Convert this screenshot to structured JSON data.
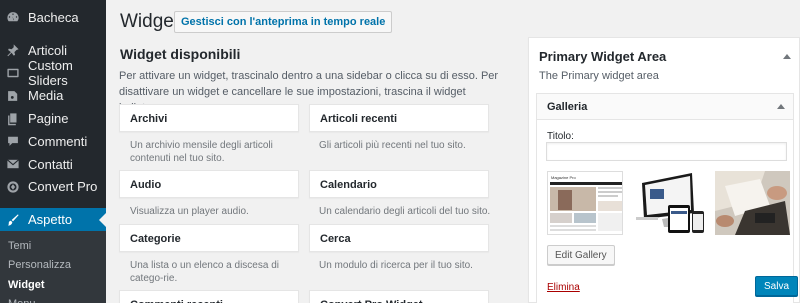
{
  "sidebar": {
    "items": [
      {
        "label": "Bacheca",
        "icon": "dashboard-icon"
      },
      {
        "label": "Articoli",
        "icon": "pin-icon"
      },
      {
        "label": "Custom Sliders",
        "icon": "sliders-icon"
      },
      {
        "label": "Media",
        "icon": "media-icon"
      },
      {
        "label": "Pagine",
        "icon": "pages-icon"
      },
      {
        "label": "Commenti",
        "icon": "comments-icon"
      },
      {
        "label": "Contatti",
        "icon": "envelope-icon"
      },
      {
        "label": "Convert Pro",
        "icon": "convert-pro-icon"
      },
      {
        "label": "Aspetto",
        "icon": "paintbrush-icon"
      }
    ],
    "submenu": [
      "Temi",
      "Personalizza",
      "Widget",
      "Menu"
    ]
  },
  "header": {
    "title": "Widget",
    "preview_label": "Gestisci con l'anteprima in tempo reale"
  },
  "available": {
    "title": "Widget disponibili",
    "description": "Per attivare un widget, trascinalo dentro a una sidebar o clicca su di esso. Per disattivare un widget e cancellare le sue impostazioni, trascina il widget indietro.",
    "widgets": [
      {
        "name": "Archivi",
        "desc": "Un archivio mensile degli articoli contenuti nel tuo sito."
      },
      {
        "name": "Articoli recenti",
        "desc": "Gli articoli più recenti nel tuo sito."
      },
      {
        "name": "Audio",
        "desc": "Visualizza un player audio."
      },
      {
        "name": "Calendario",
        "desc": "Un calendario degli articoli del tuo sito."
      },
      {
        "name": "Categorie",
        "desc": "Una lista o un elenco a discesa di catego-rie."
      },
      {
        "name": "Cerca",
        "desc": "Un modulo di ricerca per il tuo sito."
      },
      {
        "name": "Commenti recenti",
        "desc": ""
      },
      {
        "name": "Convert Pro Widget",
        "desc": ""
      }
    ]
  },
  "widget_area": {
    "title": "Primary Widget Area",
    "description": "The Primary widget area",
    "widget": {
      "title": "Galleria",
      "field_label": "Titolo:",
      "field_value": "",
      "thumb_caption": "Magazine Pro",
      "edit_label": "Edit Gallery",
      "delete_label": "Elimina",
      "save_label": "Salva"
    }
  },
  "colors": {
    "accent": "#0073aa",
    "sidebar_bg": "#23282d",
    "delete": "#aa0000",
    "save": "#0085ba"
  }
}
